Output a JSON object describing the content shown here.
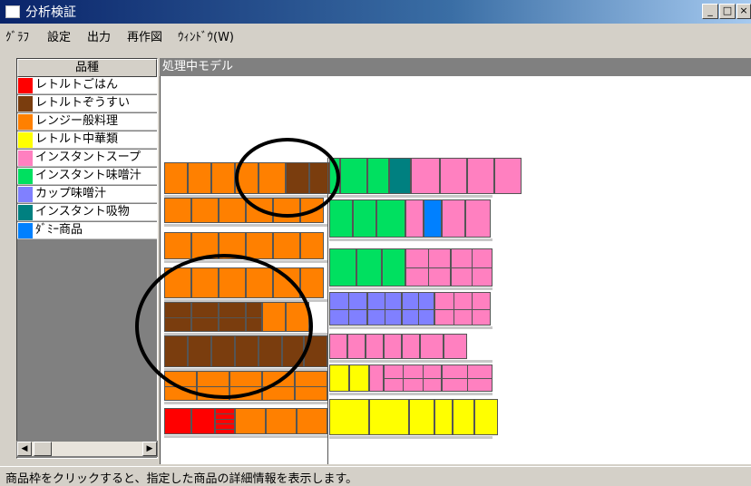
{
  "window": {
    "title": "分析検証",
    "btn_min": "_",
    "btn_max": "□",
    "btn_close": "×"
  },
  "menu": [
    {
      "label": "ｸﾞﾗﾌ"
    },
    {
      "label": "設定"
    },
    {
      "label": "出力"
    },
    {
      "label": "再作図"
    },
    {
      "label": "ｳｨﾝﾄﾞｳ(W)"
    }
  ],
  "legend": {
    "header": "品種",
    "items": [
      {
        "label": "レトルトごはん",
        "color": "#ff0000"
      },
      {
        "label": "レトルトぞうすい",
        "color": "#7a3d0e"
      },
      {
        "label": "レンジー般料理",
        "color": "#ff8000"
      },
      {
        "label": "レトルト中華類",
        "color": "#ffff00"
      },
      {
        "label": "インスタントスープ",
        "color": "#ff80c0"
      },
      {
        "label": "インスタント味噌汁",
        "color": "#00e060"
      },
      {
        "label": "カップ味噌汁",
        "color": "#8080ff"
      },
      {
        "label": "インスタント吸物",
        "color": "#008080"
      },
      {
        "label": "ﾀﾞﾐｰ商品",
        "color": "#0080ff"
      }
    ]
  },
  "scroll": {
    "left_arrow": "◀",
    "right_arrow": "▶"
  },
  "model": {
    "header": "処理中モデル"
  },
  "status": {
    "text": "商品枠をクリックすると、指定した商品の詳細情報を表示します。"
  }
}
